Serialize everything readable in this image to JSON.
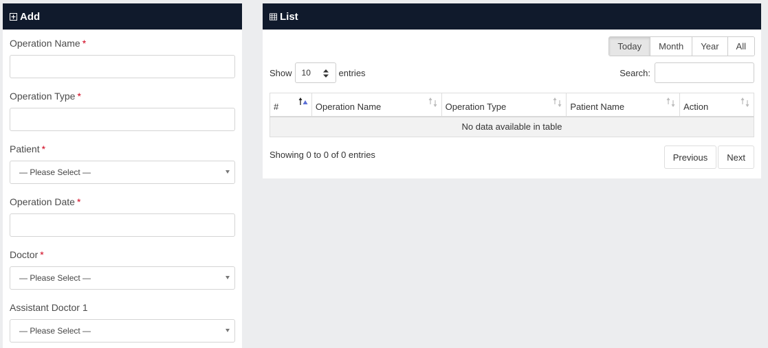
{
  "add_panel": {
    "title": "Add",
    "icon": "plus-square-icon",
    "required_mark": "*",
    "fields": [
      {
        "label": "Operation Name",
        "type": "text",
        "required": true,
        "value": ""
      },
      {
        "label": "Operation Type",
        "type": "text",
        "required": true,
        "value": ""
      },
      {
        "label": "Patient",
        "type": "select",
        "required": true,
        "value": "— Please Select —"
      },
      {
        "label": "Operation Date",
        "type": "text",
        "required": true,
        "value": ""
      },
      {
        "label": "Doctor",
        "type": "select",
        "required": true,
        "value": "— Please Select —"
      },
      {
        "label": "Assistant Doctor 1",
        "type": "select",
        "required": false,
        "value": "— Please Select —"
      }
    ]
  },
  "list_panel": {
    "title": "List",
    "icon": "table-icon",
    "period_buttons": [
      {
        "label": "Today",
        "active": true
      },
      {
        "label": "Month",
        "active": false
      },
      {
        "label": "Year",
        "active": false
      },
      {
        "label": "All",
        "active": false
      }
    ],
    "length": {
      "prefix": "Show",
      "value": "10",
      "suffix": "entries"
    },
    "search": {
      "label": "Search:",
      "value": ""
    },
    "columns": [
      "#",
      "Operation Name",
      "Operation Type",
      "Patient Name",
      "Action"
    ],
    "empty_message": "No data available in table",
    "info": "Showing 0 to 0 of 0 entries",
    "pagination": {
      "previous": "Previous",
      "next": "Next"
    }
  },
  "colors": {
    "header_bg": "#101a2c",
    "page_bg": "#ecedef",
    "required": "#d0021b",
    "sort_active": "#5b6fd6"
  }
}
